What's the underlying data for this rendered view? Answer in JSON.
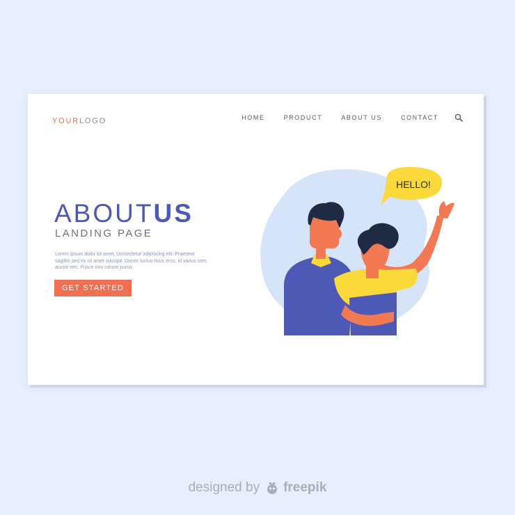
{
  "logo": {
    "part1": "YOUR",
    "part2": "LOGO"
  },
  "nav": {
    "items": [
      "HOME",
      "PRODUCT",
      "ABOUT US",
      "CONTACT"
    ]
  },
  "hero": {
    "title_light": "ABOUT",
    "title_bold": "US",
    "subtitle": "LANDING PAGE",
    "body": "Lorem ipsum dolor sit amet, consectetur adipiscing elit. Praesent sagittis sed ex sit amet suscipit. Donec luctus risus eros, id varius sem auctor nec. Fusce non rutrum purus.",
    "cta_label": "GET STARTED"
  },
  "illustration": {
    "speech_text": "HELLO!"
  },
  "credit": {
    "prefix": "designed by",
    "brand": "freepik"
  },
  "colors": {
    "accent": "#ef6f51",
    "primary": "#4d59b4",
    "blob": "#d6e4fa",
    "yellow": "#fbd93b",
    "skin": "#f17a55",
    "hair": "#1f2b44"
  },
  "icons": {
    "search": "search-icon",
    "freepik": "freepik-logo-icon"
  }
}
